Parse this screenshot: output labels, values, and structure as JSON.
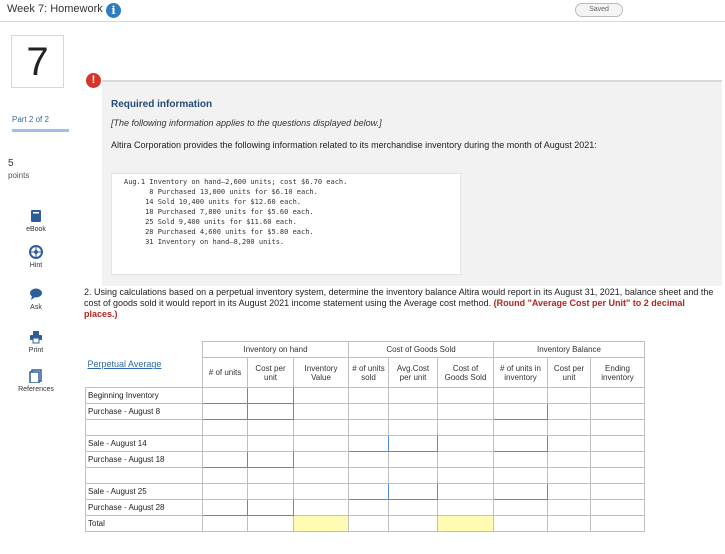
{
  "header": {
    "title": "Week 7: Homework",
    "saved": "Saved"
  },
  "left": {
    "question_number": "7",
    "part": "Part 2 of 2",
    "points_value": "5",
    "points_label": "points",
    "tools": [
      "eBook",
      "Hint",
      "Ask",
      "Print",
      "References"
    ]
  },
  "required": {
    "title": "Required information",
    "note": "[The following information applies to the questions displayed below.]",
    "intro": "Altira Corporation provides the following information related to its merchandise inventory during the month of August 2021:",
    "lines": [
      "Aug.1 Inventory on hand–2,600 units; cost $6.70 each.",
      "      8 Purchased 13,000 units for $6.10 each.",
      "     14 Sold 10,400 units for $12.60 each.",
      "     18 Purchased 7,800 units for $5.60 each.",
      "     25 Sold 9,400 units for $11.60 each.",
      "     28 Purchased 4,600 units for $5.80 each.",
      "     31 Inventory on hand–8,200 units."
    ]
  },
  "question": {
    "text": "2. Using calculations based on a perpetual inventory system, determine the inventory balance Altira would report in its August 31, 2021, balance sheet and the cost of goods sold it would report in its August 2021 income statement using the Average cost method.",
    "emphasis": "(Round \"Average Cost per Unit\" to 2 decimal places.)"
  },
  "table": {
    "title": "Perpetual Average",
    "groups": {
      "on_hand": "Inventory on hand",
      "cogs": "Cost of Goods Sold",
      "balance": "Inventory Balance"
    },
    "columns": {
      "units": "# of units",
      "cost_per_unit": "Cost per unit",
      "inventory_value": "Inventory Value",
      "units_sold": "# of units sold",
      "avg_cost": "Avg.Cost per unit",
      "cogs": "Cost of Goods Sold",
      "units_in_inventory": "# of units in inventory",
      "bal_cost_per_unit": "Cost per unit",
      "ending_inventory": "Ending inventory"
    },
    "rows": {
      "beginning": "Beginning Inventory",
      "purchase8": "Purchase - August 8",
      "sale14": "Sale - August 14",
      "purchase18": "Purchase - August 18",
      "sale25": "Sale - August 25",
      "purchase28": "Purchase - August 28",
      "total": "Total"
    }
  }
}
